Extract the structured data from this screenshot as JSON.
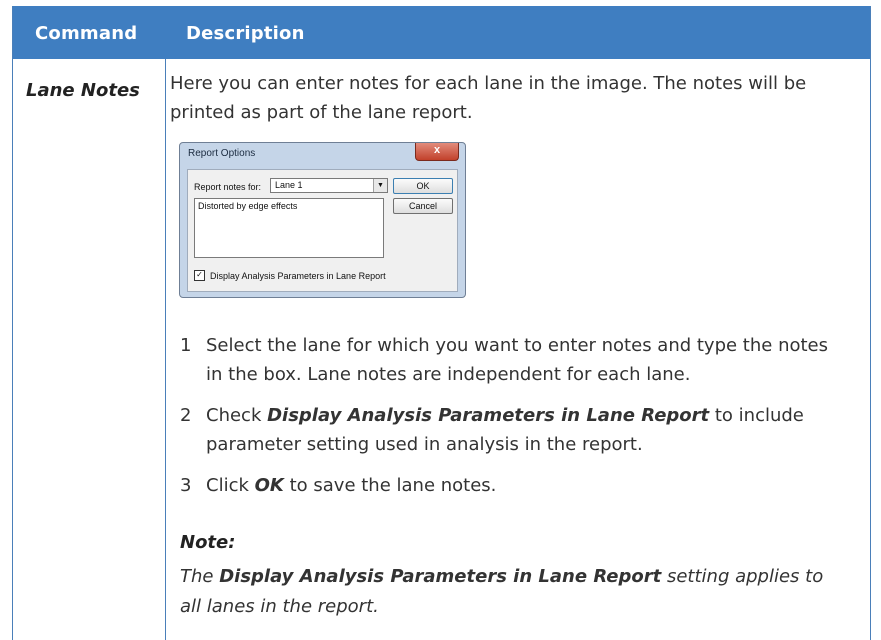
{
  "table": {
    "headers": {
      "command": "Command",
      "description": "Description"
    },
    "row": {
      "command": "Lane Notes",
      "intro": "Here you can enter notes for each lane in the image. The notes will be printed as part of the lane report.",
      "dialog": {
        "title": "Report Options",
        "close": "x",
        "report_notes_label": "Report notes for:",
        "lane_select_value": "Lane 1",
        "ok_label": "OK",
        "cancel_label": "Cancel",
        "notes_text": "Distorted by edge effects",
        "checkbox_label": "Display Analysis Parameters in Lane Report",
        "checkbox_checked": true
      },
      "steps": [
        {
          "num": "1",
          "text": "Select the lane for which you want to enter notes and type the notes in the box. Lane notes are independent for each lane."
        },
        {
          "num": "2",
          "pre": "Check ",
          "bold": "Display Analysis Parameters in Lane Report",
          "post": " to include parameter setting used in analysis in the report."
        },
        {
          "num": "3",
          "pre": "Click ",
          "bold": "OK",
          "post": " to save the lane notes."
        }
      ],
      "note": {
        "heading": "Note:",
        "pre": "The ",
        "bold": "Display Analysis Parameters in Lane Report",
        "post": " setting applies to all lanes in the report."
      }
    }
  },
  "colors": {
    "header_bg": "#3f7ec1",
    "border": "#4a7fb9"
  }
}
